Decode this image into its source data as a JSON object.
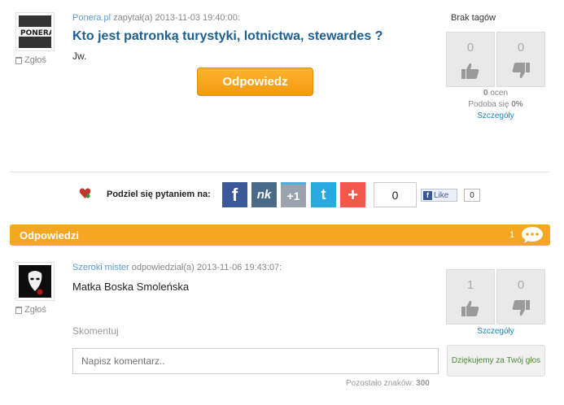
{
  "question": {
    "author": "Ponera.pl",
    "meta": "zapytał(a) 2013-11-03 19:40:00:",
    "title": "Kto jest patronką turystyki, lotnictwa, stewardes ?",
    "body": "Jw.",
    "report_label": "Zgłoś",
    "answer_button": "Odpowiedz",
    "tags_label": "Brak tagów",
    "votes_up": "0",
    "votes_down": "0",
    "ratings_count": "0",
    "ratings_suffix": "ocen",
    "likes_prefix": "Podoba się",
    "likes_percent": "0%",
    "details_link": "Szczegóły"
  },
  "share": {
    "label": "Podziel się pytaniem na:",
    "counter": "0",
    "like_label": "Like",
    "like_count": "0",
    "buttons": [
      "f",
      "nk",
      "+1",
      "t",
      "+"
    ]
  },
  "answers_bar": {
    "title": "Odpowiedzi",
    "count": "1"
  },
  "answer": {
    "author": "Szeroki mister",
    "meta": "odpowiedział(a) 2013-11-06 19:43:07:",
    "text": "Matka Boska Smoleńska",
    "report_label": "Zgłoś",
    "votes_up": "1",
    "votes_down": "0",
    "details_link": "Szczegóły",
    "comment_label": "Skomentuj",
    "comment_placeholder": "Napisz komentarz..",
    "chars_label": "Pozostało znaków:",
    "chars_value": "300",
    "thanks_label": "Dziękujemy za Twój głos"
  },
  "colors": {
    "accent_orange": "#f5a623",
    "link_blue": "#1c84b5",
    "title_blue": "#1d5f8e"
  }
}
